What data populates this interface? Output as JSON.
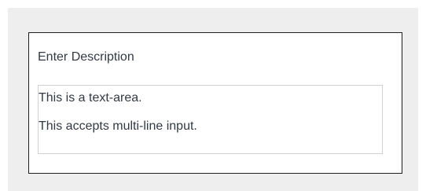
{
  "form": {
    "label": "Enter Description",
    "textarea": {
      "lines": [
        "This is a text-area.",
        "This accepts multi-line input."
      ]
    }
  },
  "colors": {
    "page_background": "#eeeeee",
    "card_border": "#1f1f1f",
    "text": "#333a44",
    "textarea_border": "#d2d2d2"
  }
}
